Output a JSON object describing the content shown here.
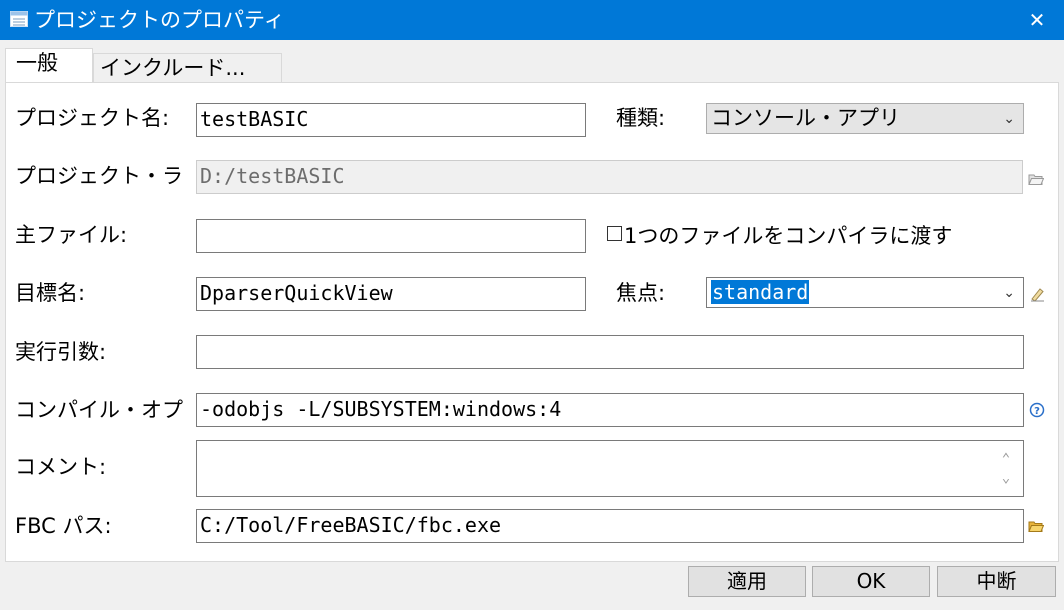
{
  "window": {
    "title": "プロジェクトのプロパティ",
    "close_glyph": "✕"
  },
  "tabs": [
    {
      "label": "一般",
      "active": true
    },
    {
      "label": "インクルード...",
      "active": false
    }
  ],
  "form": {
    "project_name": {
      "label": "プロジェクト名:",
      "value": "testBASIC"
    },
    "type": {
      "label": "種類:",
      "value": "コンソール・アプリ"
    },
    "project_folder": {
      "label": "プロジェクト・ラ",
      "value": "D:/testBASIC"
    },
    "main_file": {
      "label": "主ファイル:",
      "value": ""
    },
    "single_file_checkbox": {
      "label": "1つのファイルをコンパイラに渡す",
      "checked": false
    },
    "target_name": {
      "label": "目標名:",
      "value": "DparserQuickView"
    },
    "focus": {
      "label": "焦点:",
      "value": "standard"
    },
    "run_args": {
      "label": "実行引数:",
      "value": ""
    },
    "compile_options": {
      "label": "コンパイル・オプ",
      "value": "-odobjs -L/SUBSYSTEM:windows:4"
    },
    "comment": {
      "label": "コメント:",
      "value": ""
    },
    "fbc_path": {
      "label": "FBC パス:",
      "value": "C:/Tool/FreeBASIC/fbc.exe"
    }
  },
  "buttons": {
    "apply": "適用",
    "ok": "OK",
    "cancel": "中断"
  },
  "colors": {
    "titlebar": "#0078d7",
    "selection": "#0078d7",
    "folder_icon": "#e8b33a"
  }
}
